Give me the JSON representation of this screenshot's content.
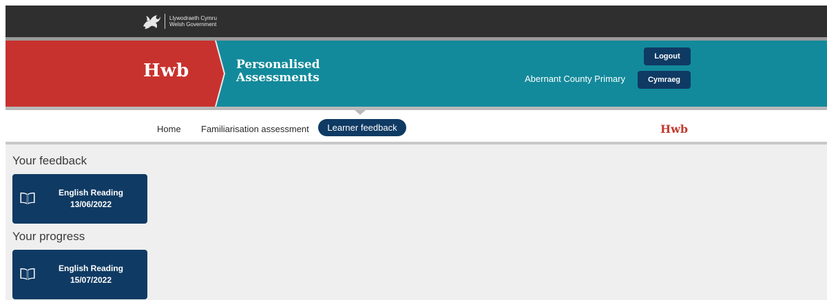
{
  "gov": {
    "line1": "Llywodraeth Cymru",
    "line2": "Welsh Government",
    "logo_icon": "welsh-dragon-icon"
  },
  "header": {
    "brand": "Hwb",
    "product_line1": "Personalised",
    "product_line2": "Assessments",
    "school": "Abernant County Primary",
    "logout_label": "Logout",
    "language_label": "Cymraeg",
    "colors": {
      "red": "#c8322e",
      "teal": "#128a9b",
      "navy": "#0f3a63"
    }
  },
  "nav": {
    "items": [
      {
        "label": "Home",
        "active": false
      },
      {
        "label": "Familiarisation assessment",
        "active": false
      },
      {
        "label": "Learner feedback",
        "active": true
      }
    ],
    "brand_small": "Hwb"
  },
  "main": {
    "feedback_title": "Your feedback",
    "progress_title": "Your progress",
    "feedback_cards": [
      {
        "title": "English Reading",
        "date": "13/06/2022",
        "icon": "open-book-icon"
      }
    ],
    "progress_cards": [
      {
        "title": "English Reading",
        "date": "15/07/2022",
        "icon": "open-book-icon"
      }
    ]
  }
}
